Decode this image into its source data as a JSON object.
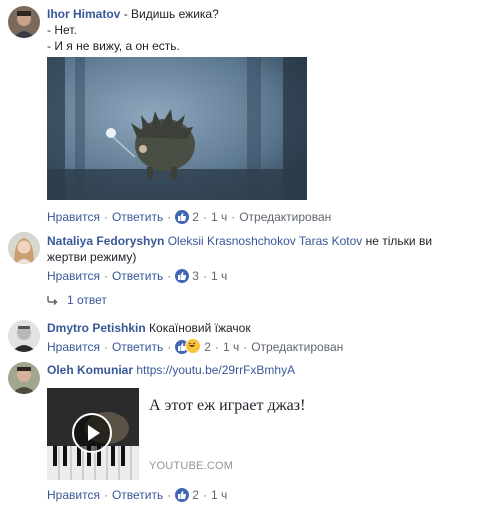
{
  "comments": [
    {
      "author": "Ihor Himatov",
      "lines": [
        "- Видишь ежика?",
        "- Нет.",
        "- И я не вижу, а он есть."
      ],
      "actions": {
        "like": "Нравится",
        "reply": "Ответить",
        "reactions": "2",
        "time": "1 ч",
        "edited": "Отредактирован"
      }
    },
    {
      "author": "Nataliya Fedoryshyn",
      "mentions": [
        "Oleksii Krasnoshchokov",
        "Taras Kotov"
      ],
      "text_after": " не тільки ви",
      "text_line2": "жертви режиму)",
      "actions": {
        "like": "Нравится",
        "reply": "Ответить",
        "reactions": "3",
        "time": "1 ч"
      },
      "replies": {
        "label": "1 ответ"
      }
    },
    {
      "author": "Dmytro Petishkin",
      "text": "Кокаїновий їжачок",
      "actions": {
        "like": "Нравится",
        "reply": "Ответить",
        "reactions": "2",
        "time": "1 ч",
        "edited": "Отредактирован"
      }
    },
    {
      "author": "Oleh Komuniar",
      "link": "https://youtu.be/29rrFxBmhyA",
      "preview": {
        "title": "А этот еж играет джаз!",
        "source": "YOUTUBE.COM"
      },
      "actions": {
        "like": "Нравится",
        "reply": "Ответить",
        "reactions": "2",
        "time": "1 ч"
      }
    }
  ],
  "colors": {
    "link": "#385898",
    "meta": "#606770",
    "like": "#4267b2"
  }
}
